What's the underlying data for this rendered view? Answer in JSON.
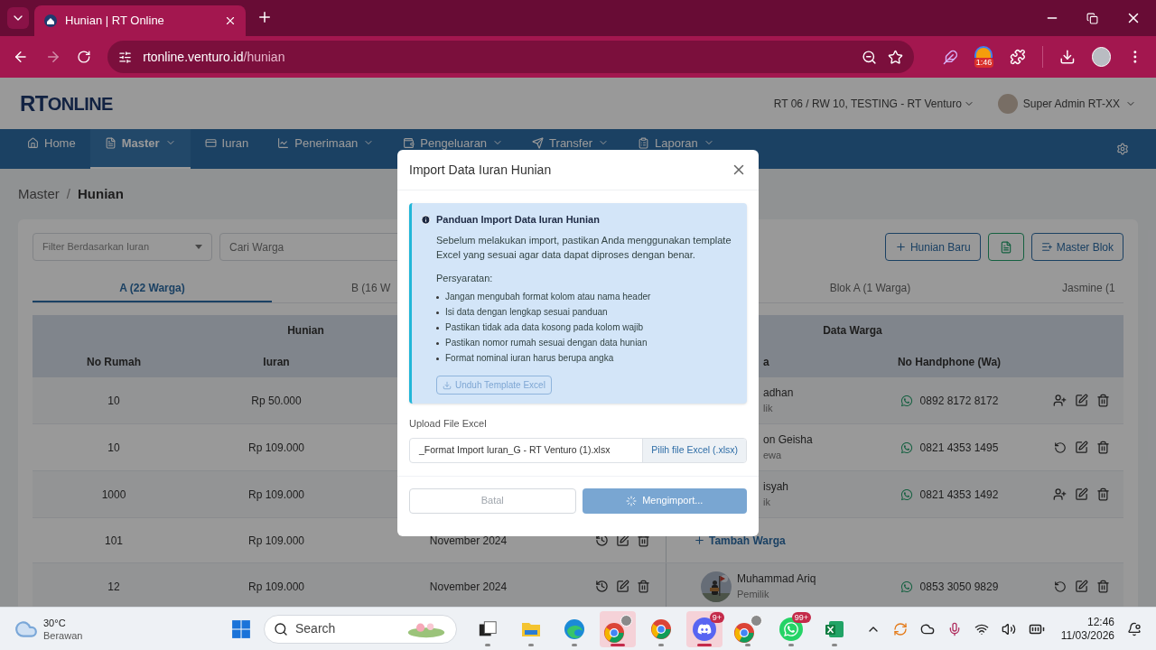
{
  "browser": {
    "tab_title": "Hunian | RT Online",
    "url_host": "rtonline.venturo.id",
    "url_path": "/hunian",
    "extension_badge": "1:46"
  },
  "header": {
    "logo_main": "RT",
    "logo_rest": "ONLINE",
    "org_selector": "RT 06 / RW 10, TESTING - RT Venturo",
    "user": "Super Admin RT-XX"
  },
  "nav": [
    {
      "label": "Home",
      "dropdown": false,
      "selected": false
    },
    {
      "label": "Master",
      "dropdown": true,
      "selected": true
    },
    {
      "label": "Iuran",
      "dropdown": false,
      "selected": false
    },
    {
      "label": "Penerimaan",
      "dropdown": true,
      "selected": false
    },
    {
      "label": "Pengeluaran",
      "dropdown": true,
      "selected": false
    },
    {
      "label": "Transfer",
      "dropdown": true,
      "selected": false
    },
    {
      "label": "Laporan",
      "dropdown": true,
      "selected": false
    }
  ],
  "breadcrumb": {
    "items": [
      "Master",
      "Hunian"
    ],
    "separator": "/"
  },
  "toolbar": {
    "filter_placeholder": "Filter Berdasarkan Iuran",
    "search_placeholder": "Cari Warga",
    "buttons": [
      {
        "kind": "add",
        "label": "Hunian Baru"
      },
      {
        "kind": "export"
      },
      {
        "kind": "blocks",
        "label": "Master Blok"
      }
    ]
  },
  "block_tabs": [
    {
      "label": "A (22 Warga)",
      "selected": true
    },
    {
      "label": "B (16 W",
      "selected": false
    },
    {
      "label": "Blok A (1 Warga)",
      "selected": false
    },
    {
      "label": "Jasmine (1",
      "selected": false
    }
  ],
  "table": {
    "groups": [
      "Hunian",
      "Data Warga"
    ],
    "headers": {
      "no_rumah": "No Rumah",
      "iuran": "Iuran",
      "warga": "a",
      "phone": "No Handphone (Wa)"
    },
    "rows": [
      {
        "kind": "add-member",
        "no": "10",
        "iuran": "Rp 50.000",
        "name": "adhan",
        "role": "lik",
        "phone": "0892 8172 8172"
      },
      {
        "kind": "reset",
        "no": "10",
        "iuran": "Rp 109.000",
        "name": "on Geisha",
        "role": "ewa",
        "phone": "0821 4353 1495"
      },
      {
        "kind": "add-member",
        "no": "1000",
        "iuran": "Rp 109.000",
        "name": "isyah",
        "role": "ik",
        "phone": "0821 4353 1492"
      },
      {
        "kind": "empty",
        "no": "101",
        "iuran": "Rp 109.000",
        "period": "November 2024",
        "add_resident": "Tambah Warga"
      },
      {
        "kind": "reset",
        "no": "12",
        "iuran": "Rp 109.000",
        "period": "November 2024",
        "name": "Muhammad Ariq",
        "role": "Pemilik",
        "phone": "0853 3050 9829"
      }
    ]
  },
  "modal": {
    "title": "Import Data Iuran Hunian",
    "guide": {
      "title": "Panduan Import Data Iuran Hunian",
      "text": "Sebelum melakukan import, pastikan Anda menggunakan template Excel yang sesuai agar data dapat diproses dengan benar.",
      "requirements_title": "Persyaratan:",
      "requirements": [
        "Jangan mengubah format kolom atau nama header",
        "Isi data dengan lengkap sesuai panduan",
        "Pastikan tidak ada data kosong pada kolom wajib",
        "Pastikan nomor rumah sesuai dengan data hunian",
        "Format nominal iuran harus berupa angka"
      ],
      "template_button": {
        "label": "Unduh Template Excel",
        "disabled": true
      }
    },
    "upload": {
      "label": "Upload File Excel",
      "value": "_Format Import Iuran_G - RT Venturo (1).xlsx",
      "button": "Pilih file Excel (.xlsx)"
    },
    "buttons": [
      {
        "kind": "cancel",
        "label": "Batal",
        "disabled": true
      },
      {
        "kind": "submit",
        "label": "Mengimport...",
        "disabled": true,
        "loading": true
      }
    ]
  },
  "taskbar": {
    "weather_temp": "30°C",
    "weather_text": "Berawan",
    "search_placeholder": "Search",
    "apps": [
      {
        "kind": "taskview",
        "selected": false
      },
      {
        "kind": "folder",
        "selected": false
      },
      {
        "kind": "edge",
        "selected": false
      },
      {
        "kind": "chrome-profile",
        "selected": true
      },
      {
        "kind": "chrome",
        "selected": false
      },
      {
        "kind": "discord",
        "selected": true,
        "badge": "9+"
      },
      {
        "kind": "chrome-photo",
        "selected": false
      },
      {
        "kind": "whatsapp",
        "selected": false,
        "badge": "99+"
      },
      {
        "kind": "excel",
        "selected": false
      }
    ],
    "time": "12:46",
    "date": "11/03/2026"
  }
}
